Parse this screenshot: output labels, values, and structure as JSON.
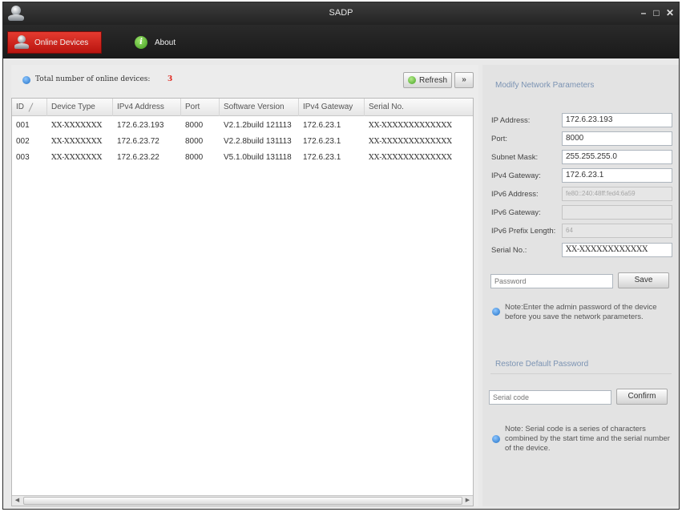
{
  "window": {
    "title": "SADP",
    "controls": {
      "minimize": "–",
      "maximize": "□",
      "close": "✕"
    }
  },
  "tabs": [
    {
      "label": "Online Devices",
      "icon": "user-device-icon",
      "active": true
    },
    {
      "label": "About",
      "icon": "about-icon",
      "active": false
    }
  ],
  "toolbar": {
    "total_label": "Total number of online devices:",
    "total_count": "3",
    "refresh_label": "Refresh",
    "expand_label": "»"
  },
  "table": {
    "columns": [
      "ID",
      "Device Type",
      "IPv4 Address",
      "Port",
      "Software Version",
      "IPv4 Gateway",
      "Serial No."
    ],
    "rows": [
      [
        "001",
        "XX-XXXXXXX",
        "172.6.23.193",
        "8000",
        "V2.1.2build 121113",
        "172.6.23.1",
        "XX-XXXXXXXXXXXXX"
      ],
      [
        "002",
        "XX-XXXXXXX",
        "172.6.23.72",
        "8000",
        "V2.2.8build 131113",
        "172.6.23.1",
        "XX-XXXXXXXXXXXXX"
      ],
      [
        "003",
        "XX-XXXXXXX",
        "172.6.23.22",
        "8000",
        "V5.1.0build 131118",
        "172.6.23.1",
        "XX-XXXXXXXXXXXXX"
      ]
    ]
  },
  "modify": {
    "title": "Modify Network Parameters",
    "fields": [
      {
        "label": "IP Address:",
        "value": "172.6.23.193",
        "disabled": false
      },
      {
        "label": "Port:",
        "value": "8000",
        "disabled": false
      },
      {
        "label": "Subnet Mask:",
        "value": "255.255.255.0",
        "disabled": false
      },
      {
        "label": "IPv4 Gateway:",
        "value": "172.6.23.1",
        "disabled": false
      },
      {
        "label": "IPv6 Address:",
        "value": "fe80::240:48ff:fed4:6a59",
        "disabled": true
      },
      {
        "label": "IPv6 Gateway:",
        "value": "",
        "disabled": true
      },
      {
        "label": "IPv6 Prefix Length:",
        "value": "64",
        "disabled": true
      },
      {
        "label": "Serial No.:",
        "value": "XX-XXXXXXXXXXXX",
        "disabled": false
      }
    ],
    "password_placeholder": "Password",
    "save_label": "Save",
    "note": "Note:Enter the admin password of the device before you save the network parameters."
  },
  "restore": {
    "title": "Restore Default Password",
    "serial_placeholder": "Serial code",
    "confirm_label": "Confirm",
    "note": "Note: Serial code is a series of characters combined by the start time and the serial number of the device."
  },
  "colors": {
    "accent_red": "#d42a20",
    "info_blue": "#1f6fc5",
    "section_title": "#7b93b3"
  }
}
